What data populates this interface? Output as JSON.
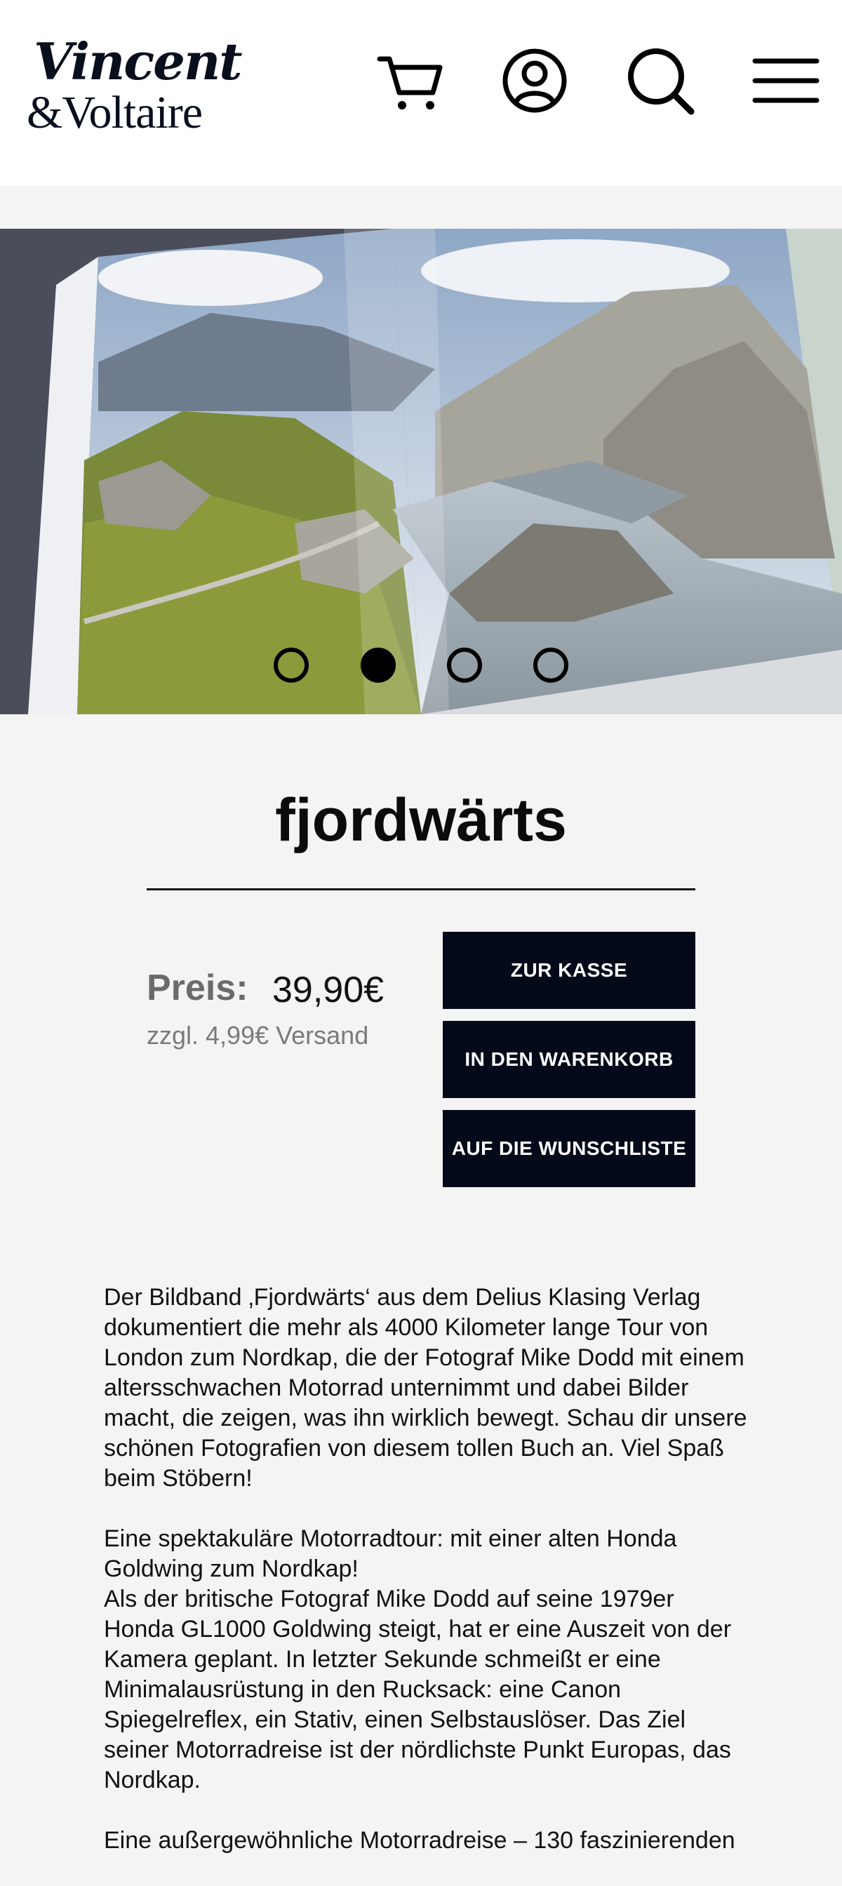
{
  "brand": {
    "logo_line1": "Vincent",
    "logo_line2": "&Voltaire"
  },
  "header": {
    "icons": [
      "cart-icon",
      "account-icon",
      "search-icon",
      "menu-icon"
    ]
  },
  "gallery": {
    "slide_count": 4,
    "active_index": 1
  },
  "product": {
    "title": "fjordwärts",
    "price_label": "Preis:",
    "price": "39,90€",
    "shipping": "zzgl. 4,99€ Versand",
    "buttons": {
      "checkout": "ZUR KASSE",
      "add_to_cart": "IN DEN WARENKORB",
      "wishlist": "AUF DIE WUNSCHLISTE"
    }
  },
  "description": {
    "p1": "Der Bildband ‚Fjordwärts‘ aus dem Delius Klasing Verlag dokumentiert die mehr als 4000 Kilometer lange Tour von London zum Nordkap, die der Fotograf Mike Dodd mit einem altersschwachen Motorrad unternimmt und dabei Bilder macht, die zeigen, was ihn wirklich bewegt. Schau dir unsere schönen Fotografien von diesem tollen Buch an. Viel Spaß beim Stöbern!",
    "p2a": "Eine spektakuläre Motorradtour: mit einer alten Honda Goldwing zum Nordkap!",
    "p2b": "Als der britische Fotograf Mike Dodd auf seine 1979er Honda GL1000 Goldwing steigt, hat er eine Auszeit von der Kamera geplant. In letzter Sekunde schmeißt er eine Minimalausrüstung in den Rucksack: eine Canon Spiegelreflex, ein Stativ, einen Selbstauslöser. Das Ziel seiner Motorradreise ist der nördlichste Punkt Europas, das Nordkap.",
    "p3": "Eine außergewöhnliche Motorradreise – 130 faszinierenden"
  },
  "colors": {
    "button_bg": "#050a1a",
    "page_bg": "#f4f4f4",
    "header_bg": "#ffffff"
  }
}
